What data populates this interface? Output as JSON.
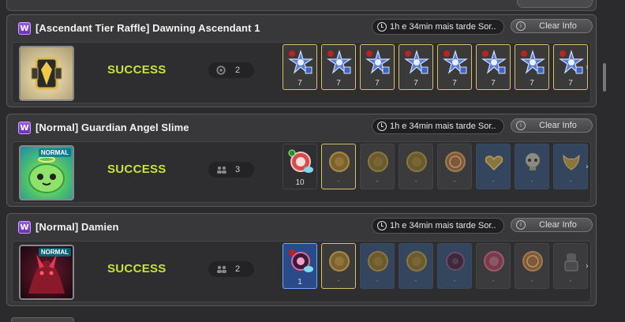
{
  "panels": [
    {
      "tier_icon": "W",
      "title": "[Ascendant Tier Raffle] Dawning Ascendant 1",
      "time": "1h e 34min mais tarde Sor..",
      "clear_label": "Clear Info",
      "status": "SUCCESS",
      "party_count": "2",
      "difficulty": "",
      "boss_icon": "ascendant-shield-icon",
      "rewards": [
        {
          "icon": "star-emblem-icon",
          "count": "7",
          "style": "gold"
        },
        {
          "icon": "star-emblem-icon",
          "count": "7",
          "style": "gold"
        },
        {
          "icon": "star-emblem-icon",
          "count": "7",
          "style": "gold"
        },
        {
          "icon": "star-emblem-icon",
          "count": "7",
          "style": "gold"
        },
        {
          "icon": "star-emblem-icon",
          "count": "7",
          "style": "gold"
        },
        {
          "icon": "star-emblem-icon",
          "count": "7",
          "style": "gold"
        },
        {
          "icon": "star-emblem-icon",
          "count": "7",
          "style": "gold"
        },
        {
          "icon": "star-emblem-icon",
          "count": "7",
          "style": "gold"
        }
      ]
    },
    {
      "tier_icon": "W",
      "title": "[Normal] Guardian Angel Slime",
      "time": "1h e 34min mais tarde Sor..",
      "clear_label": "Clear Info",
      "status": "SUCCESS",
      "party_count": "3",
      "difficulty": "NORMAL",
      "boss_icon": "guardian-angel-slime-icon",
      "rewards": [
        {
          "icon": "red-emblem-icon",
          "count": "10",
          "style": "plain"
        },
        {
          "icon": "gold-coin-icon",
          "count": "-",
          "style": "gold"
        },
        {
          "icon": "gold-coin-icon",
          "count": "-",
          "style": "plain"
        },
        {
          "icon": "gold-coin-icon",
          "count": "-",
          "style": "plain"
        },
        {
          "icon": "ornate-coin-icon",
          "count": "-",
          "style": "plain"
        },
        {
          "icon": "heart-pendant-icon",
          "count": "-",
          "style": "blue"
        },
        {
          "icon": "skull-icon",
          "count": "-",
          "style": "blue"
        },
        {
          "icon": "wing-icon",
          "count": "-",
          "style": "blue"
        }
      ]
    },
    {
      "tier_icon": "W",
      "title": "[Normal] Damien",
      "time": "1h e 34min mais tarde Sor..",
      "clear_label": "Clear Info",
      "status": "SUCCESS",
      "party_count": "2",
      "difficulty": "NORMAL",
      "boss_icon": "damien-icon",
      "rewards": [
        {
          "icon": "pink-eye-emblem-icon",
          "count": "1",
          "style": "blue-sel"
        },
        {
          "icon": "gold-coin-icon",
          "count": "-",
          "style": "gold"
        },
        {
          "icon": "gold-coin-icon",
          "count": "-",
          "style": "blue"
        },
        {
          "icon": "gold-coin-icon",
          "count": "-",
          "style": "blue"
        },
        {
          "icon": "dark-emblem-icon",
          "count": "-",
          "style": "blue"
        },
        {
          "icon": "red-emblem-icon",
          "count": "-",
          "style": "plain"
        },
        {
          "icon": "ornate-coin-icon",
          "count": "-",
          "style": "plain"
        },
        {
          "icon": "armor-icon",
          "count": "-",
          "style": "plain"
        }
      ]
    }
  ],
  "colors": {
    "success": "#c8e23a",
    "gold_border": "#d7c26a",
    "selected_blue": "#2a4a8a"
  }
}
